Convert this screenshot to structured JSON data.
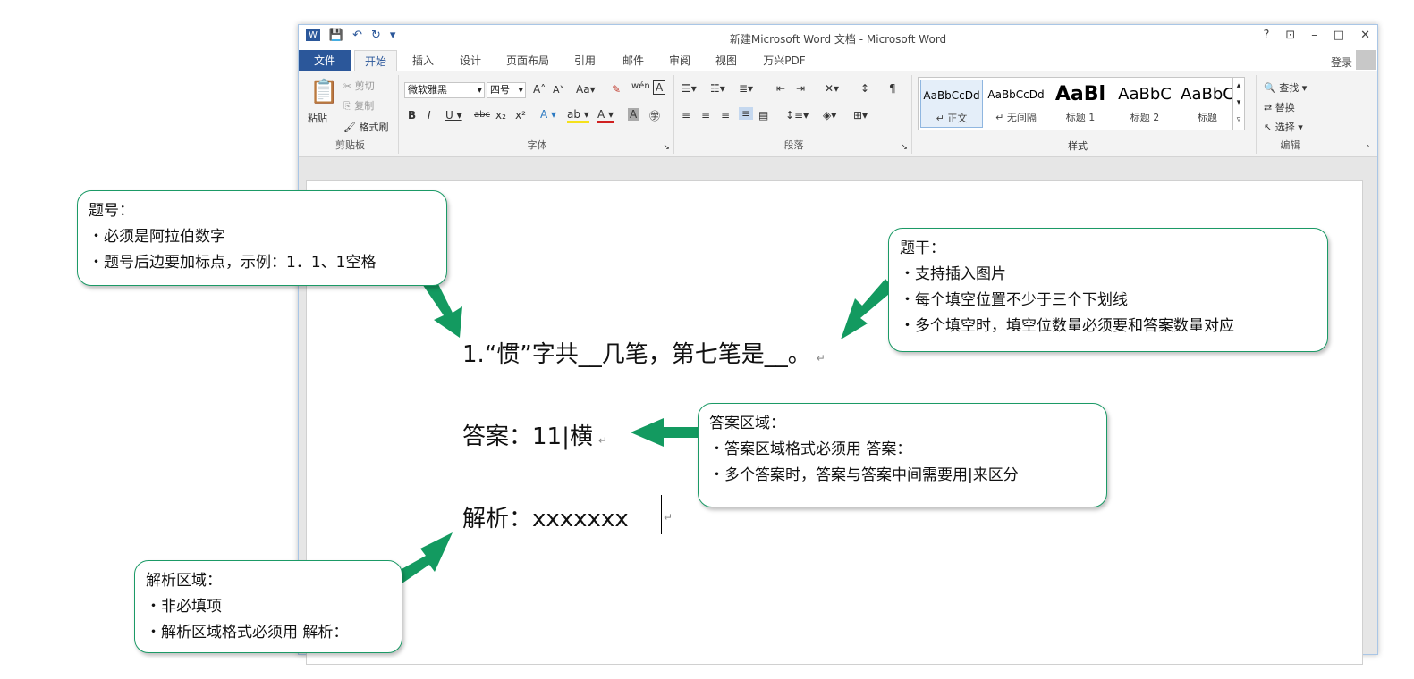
{
  "window": {
    "title": "新建Microsoft Word 文档 - Microsoft Word",
    "controls": [
      "?",
      "⊡",
      "–",
      "□",
      "✕"
    ],
    "login": "登录"
  },
  "tabs": {
    "file": "文件",
    "items": [
      "开始",
      "插入",
      "设计",
      "页面布局",
      "引用",
      "邮件",
      "审阅",
      "视图",
      "万兴PDF"
    ]
  },
  "ribbon": {
    "clipboard": {
      "paste": "粘贴",
      "cut": "剪切",
      "copy": "复制",
      "format_painter": "格式刷",
      "label": "剪贴板"
    },
    "font": {
      "name": "微软雅黑",
      "size": "四号",
      "label": "字体"
    },
    "paragraph": {
      "label": "段落"
    },
    "styles": {
      "label": "样式",
      "items": [
        {
          "preview": "AaBbCcDd",
          "name": "↵ 正文"
        },
        {
          "preview": "AaBbCcDd",
          "name": "↵ 无间隔"
        },
        {
          "preview": "AaBl",
          "name": "标题 1"
        },
        {
          "preview": "AaBbC",
          "name": "标题 2"
        },
        {
          "preview": "AaBbC",
          "name": "标题"
        }
      ]
    },
    "editing": {
      "find": "查找",
      "replace": "替换",
      "select": "选择",
      "label": "编辑"
    }
  },
  "document": {
    "question": "1.“惯”字共__几笔，第七笔是__。",
    "answer": "答案：11|横",
    "analysis": "解析：xxxxxxx"
  },
  "callouts": {
    "tihao": {
      "title": "题号：",
      "items": [
        "・必须是阿拉伯数字",
        "・题号后边要加标点，示例：1．1、1空格"
      ]
    },
    "tigan": {
      "title": "题干：",
      "items": [
        "・支持插入图片",
        "・每个填空位置不少于三个下划线",
        "・多个填空时，填空位数量必须要和答案数量对应"
      ]
    },
    "daan": {
      "title": "答案区域：",
      "items": [
        "・答案区域格式必须用 答案：",
        "・多个答案时，答案与答案中间需要用|来区分"
      ]
    },
    "jiexi": {
      "title": "解析区域：",
      "items": [
        "・非必填项",
        "・解析区域格式必须用 解析："
      ]
    }
  },
  "colors": {
    "accent": "#2b579a",
    "callout_border": "#1b9a66",
    "arrow": "#139a60"
  }
}
